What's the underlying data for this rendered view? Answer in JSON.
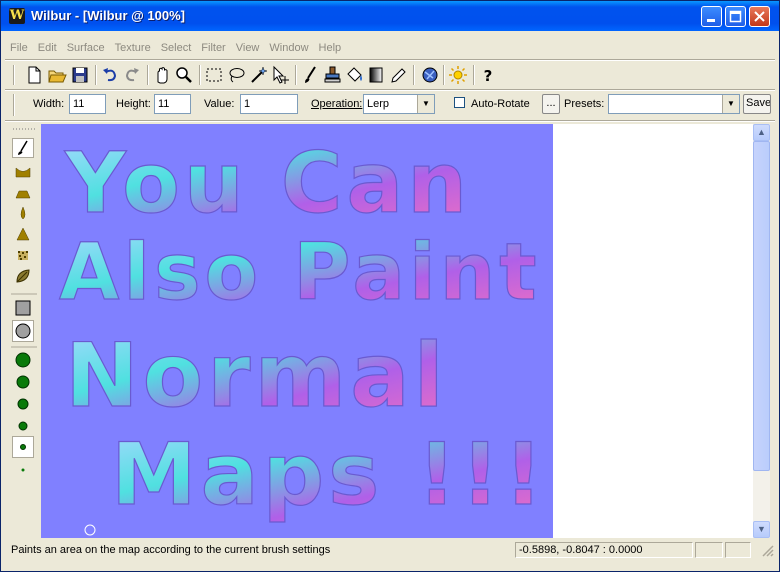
{
  "window": {
    "title": "Wilbur - [Wilbur @ 100%]",
    "app_icon_letter": "W"
  },
  "menu": [
    "File",
    "Edit",
    "Surface",
    "Texture",
    "Select",
    "Filter",
    "View",
    "Window",
    "Help"
  ],
  "toolbar": {
    "icons": [
      "new-file-icon",
      "open-folder-icon",
      "save-disk-icon",
      "undo-icon",
      "redo-icon",
      "hand-pan-icon",
      "zoom-magnifier-icon",
      "rect-select-icon",
      "lasso-select-icon",
      "magic-wand-icon",
      "move-cursor-icon",
      "brush-icon",
      "stamp-icon",
      "fill-bucket-icon",
      "gradient-icon",
      "pencil-icon",
      "render-icon",
      "light-sun-icon",
      "help-question-icon"
    ]
  },
  "options": {
    "width_label": "Width:",
    "width_value": "11",
    "height_label": "Height:",
    "height_value": "11",
    "value_label": "Value:",
    "value_value": "1",
    "operation_label": "Operation:",
    "operation_value": "Lerp",
    "autorotate_label": "Auto-Rotate",
    "dots_button": "...",
    "presets_label": "Presets:",
    "presets_value": "",
    "save_button": "Save"
  },
  "canvas": {
    "painted_text": [
      "You Can",
      "Also Paint",
      "Normal",
      "Maps !!!"
    ],
    "base_color": "#8080ff"
  },
  "status": {
    "message": "Paints an area on the map according to the current brush settings",
    "coordinates": "-0.5898, -0.8047 : 0.0000"
  }
}
